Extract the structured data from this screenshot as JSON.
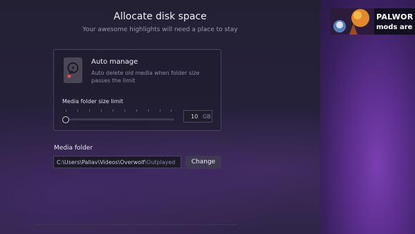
{
  "header": {
    "title": "Allocate disk space",
    "subtitle": "Your awesome highlights will need a place to stay"
  },
  "auto_manage": {
    "icon": "hard-drive-icon",
    "title": "Auto manage",
    "description": "Auto delete old media when folder size passes the limit"
  },
  "size_limit": {
    "label": "Media folder size limit",
    "value": "10",
    "unit": "GB",
    "slider_position_fraction": 0
  },
  "media_folder": {
    "label": "Media folder",
    "path_main": "C:\\Users\\Pallav\\Videos\\Overwolf",
    "path_tail": "\\Outplayed",
    "change_button": "Change"
  },
  "ad": {
    "line1": "PALWOR",
    "line2": "mods are l"
  },
  "colors": {
    "panel_bg": "#26213a",
    "side_purple": "#7a3fb0",
    "card_border": "#4a4460"
  }
}
